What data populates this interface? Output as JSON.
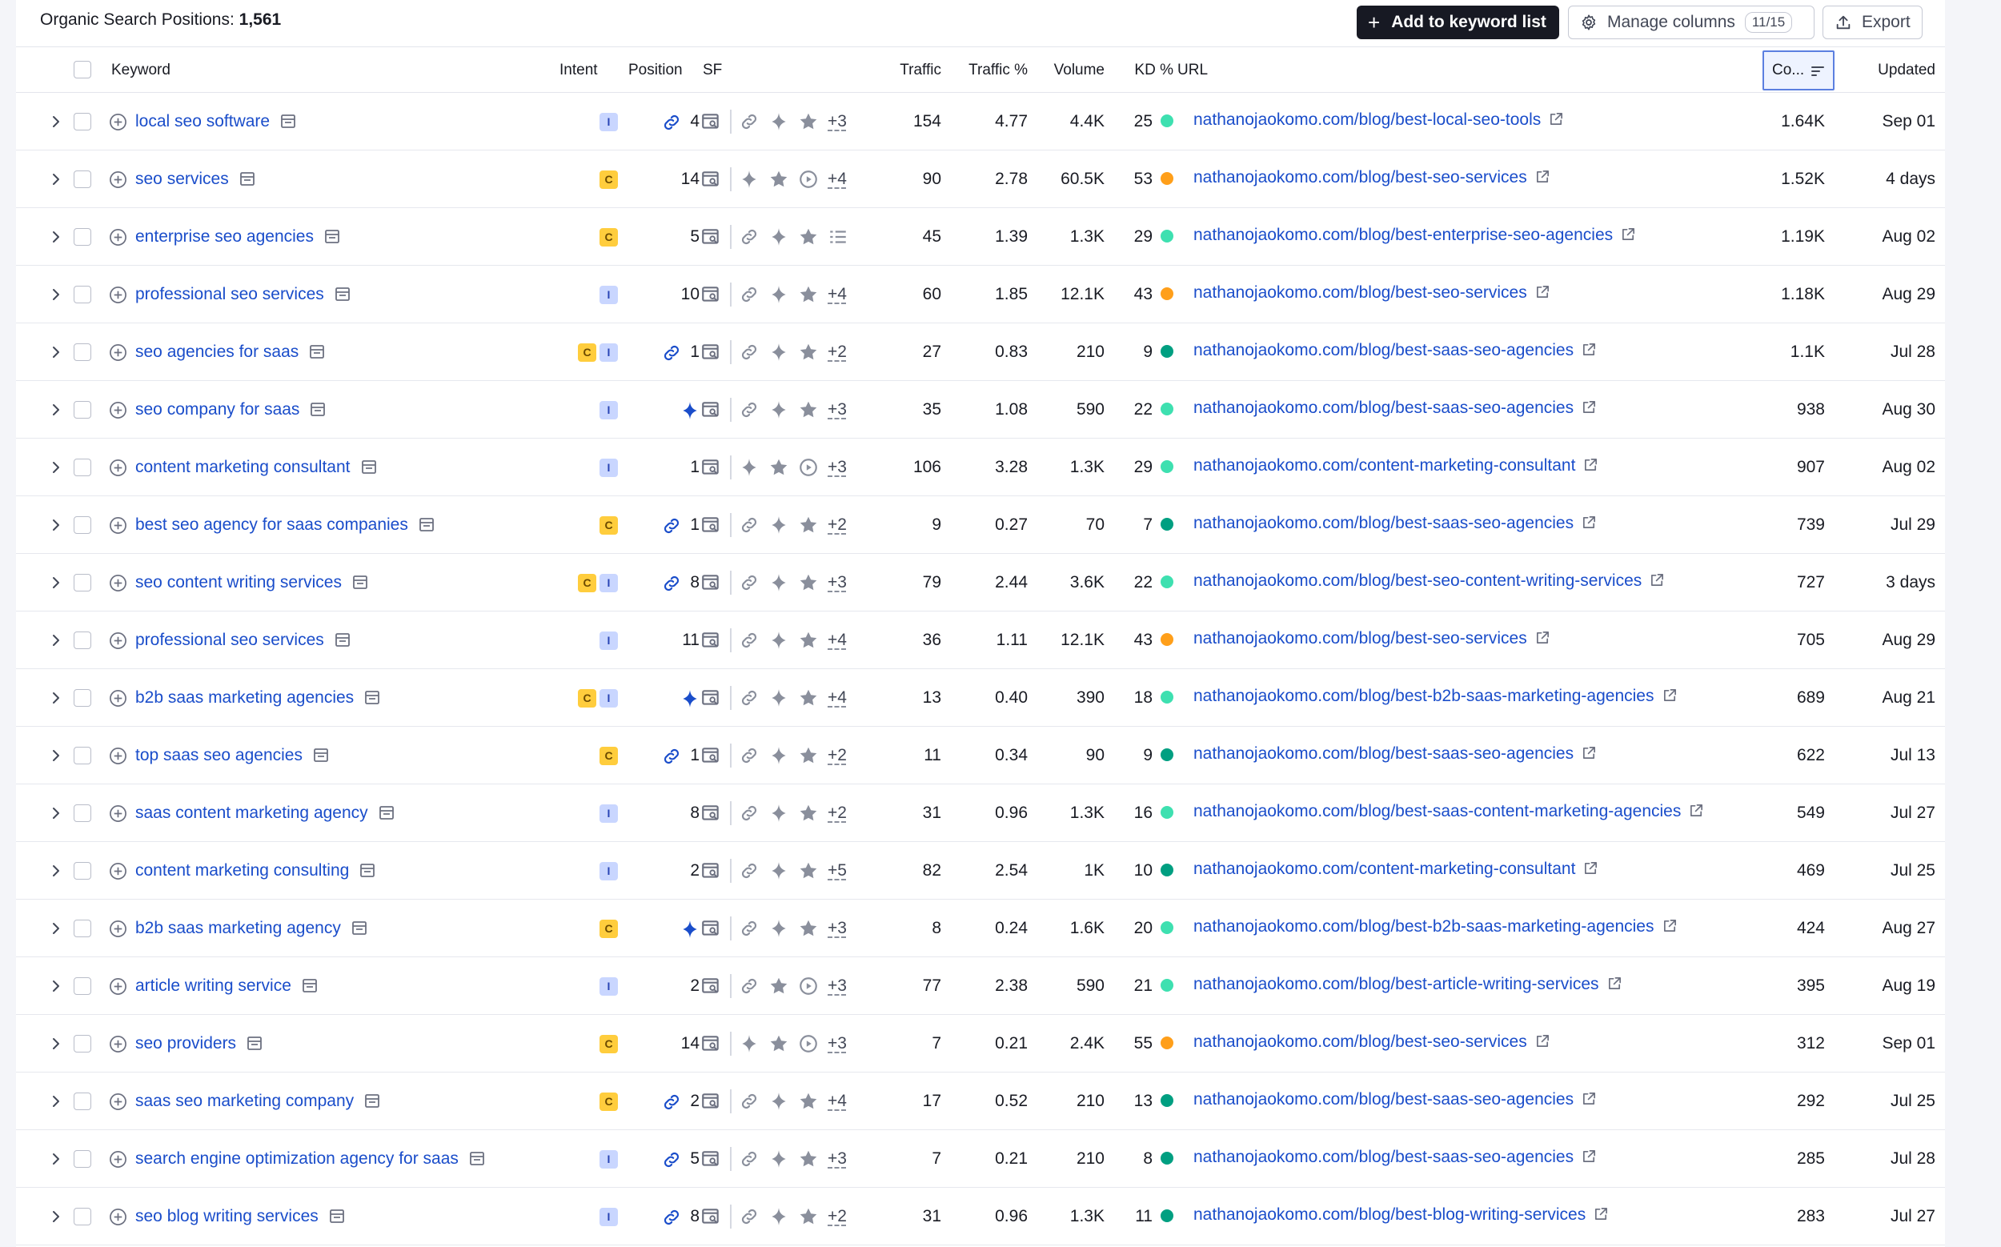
{
  "toolbar": {
    "title_label": "Organic Search Positions:",
    "title_count": "1,561",
    "add_label": "Add to keyword list",
    "manage_label": "Manage columns",
    "manage_count": "11/15",
    "export_label": "Export"
  },
  "columns": {
    "keyword": "Keyword",
    "intent": "Intent",
    "position": "Position",
    "sf": "SF",
    "traffic": "Traffic",
    "traffic_pct": "Traffic %",
    "volume": "Volume",
    "kd": "KD %",
    "url": "URL",
    "cost": "Co...",
    "updated": "Updated"
  },
  "colors": {
    "link": "#1a4dca",
    "kd_easy": "#3ee0b0",
    "kd_medium_easy": "#009f81",
    "kd_possible": "#ff9f1a",
    "intent_commercial": "#ffcd3d",
    "intent_informational": "#c9d6ff"
  },
  "rows": [
    {
      "keyword": "local seo software",
      "intent": [
        "I"
      ],
      "pos_icon": "link-icon",
      "position": "4",
      "sf": [
        "serp-icon",
        "link-icon",
        "sparkle-icon",
        "star-icon"
      ],
      "sf_more": "+3",
      "traffic": "154",
      "traffic_pct": "4.77",
      "volume": "4.4K",
      "kd": "25",
      "kd_color": "#3ee0b0",
      "url": "nathanojaokomo.com/blog/best-local-seo-tools",
      "cost": "1.64K",
      "updated": "Sep 01"
    },
    {
      "keyword": "seo services",
      "intent": [
        "C"
      ],
      "pos_icon": "",
      "position": "14",
      "sf": [
        "serp-icon",
        "sparkle-icon",
        "star-icon",
        "play-icon"
      ],
      "sf_more": "+4",
      "traffic": "90",
      "traffic_pct": "2.78",
      "volume": "60.5K",
      "kd": "53",
      "kd_color": "#ff9f1a",
      "url": "nathanojaokomo.com/blog/best-seo-services",
      "cost": "1.52K",
      "updated": "4 days"
    },
    {
      "keyword": "enterprise seo agencies",
      "intent": [
        "C"
      ],
      "pos_icon": "",
      "position": "5",
      "sf": [
        "serp-icon",
        "link-icon",
        "sparkle-icon",
        "star-icon",
        "list-icon"
      ],
      "sf_more": "",
      "traffic": "45",
      "traffic_pct": "1.39",
      "volume": "1.3K",
      "kd": "29",
      "kd_color": "#3ee0b0",
      "url": "nathanojaokomo.com/blog/best-enterprise-seo-agencies",
      "cost": "1.19K",
      "updated": "Aug 02"
    },
    {
      "keyword": "professional seo services",
      "intent": [
        "I"
      ],
      "pos_icon": "",
      "position": "10",
      "sf": [
        "serp-icon",
        "link-icon",
        "sparkle-icon",
        "star-icon"
      ],
      "sf_more": "+4",
      "traffic": "60",
      "traffic_pct": "1.85",
      "volume": "12.1K",
      "kd": "43",
      "kd_color": "#ff9f1a",
      "url": "nathanojaokomo.com/blog/best-seo-services",
      "cost": "1.18K",
      "updated": "Aug 29"
    },
    {
      "keyword": "seo agencies for saas",
      "intent": [
        "C",
        "I"
      ],
      "pos_icon": "link-icon",
      "position": "1",
      "sf": [
        "serp-icon",
        "link-icon",
        "sparkle-icon",
        "star-icon"
      ],
      "sf_more": "+2",
      "traffic": "27",
      "traffic_pct": "0.83",
      "volume": "210",
      "kd": "9",
      "kd_color": "#009f81",
      "url": "nathanojaokomo.com/blog/best-saas-seo-agencies",
      "cost": "1.1K",
      "updated": "Jul 28"
    },
    {
      "keyword": "seo company for saas",
      "intent": [
        "I"
      ],
      "pos_icon": "sparkle-icon",
      "position": "",
      "sf": [
        "serp-icon",
        "link-icon",
        "sparkle-icon",
        "star-icon"
      ],
      "sf_more": "+3",
      "traffic": "35",
      "traffic_pct": "1.08",
      "volume": "590",
      "kd": "22",
      "kd_color": "#3ee0b0",
      "url": "nathanojaokomo.com/blog/best-saas-seo-agencies",
      "cost": "938",
      "updated": "Aug 30"
    },
    {
      "keyword": "content marketing consultant",
      "intent": [
        "I"
      ],
      "pos_icon": "",
      "position": "1",
      "sf": [
        "serp-icon",
        "sparkle-icon",
        "star-icon",
        "play-icon"
      ],
      "sf_more": "+3",
      "traffic": "106",
      "traffic_pct": "3.28",
      "volume": "1.3K",
      "kd": "29",
      "kd_color": "#3ee0b0",
      "url": "nathanojaokomo.com/content-marketing-consultant",
      "cost": "907",
      "updated": "Aug 02"
    },
    {
      "keyword": "best seo agency for saas companies",
      "intent": [
        "C"
      ],
      "pos_icon": "link-icon",
      "position": "1",
      "sf": [
        "serp-icon",
        "link-icon",
        "sparkle-icon",
        "star-icon"
      ],
      "sf_more": "+2",
      "traffic": "9",
      "traffic_pct": "0.27",
      "volume": "70",
      "kd": "7",
      "kd_color": "#009f81",
      "url": "nathanojaokomo.com/blog/best-saas-seo-agencies",
      "cost": "739",
      "updated": "Jul 29"
    },
    {
      "keyword": "seo content writing services",
      "intent": [
        "C",
        "I"
      ],
      "pos_icon": "link-icon",
      "position": "8",
      "sf": [
        "serp-icon",
        "link-icon",
        "sparkle-icon",
        "star-icon"
      ],
      "sf_more": "+3",
      "traffic": "79",
      "traffic_pct": "2.44",
      "volume": "3.6K",
      "kd": "22",
      "kd_color": "#3ee0b0",
      "url": "nathanojaokomo.com/blog/best-seo-content-writing-services",
      "cost": "727",
      "updated": "3 days"
    },
    {
      "keyword": "professional seo services",
      "intent": [
        "I"
      ],
      "pos_icon": "",
      "position": "11",
      "sf": [
        "serp-icon",
        "link-icon",
        "sparkle-icon",
        "star-icon"
      ],
      "sf_more": "+4",
      "traffic": "36",
      "traffic_pct": "1.11",
      "volume": "12.1K",
      "kd": "43",
      "kd_color": "#ff9f1a",
      "url": "nathanojaokomo.com/blog/best-seo-services",
      "cost": "705",
      "updated": "Aug 29"
    },
    {
      "keyword": "b2b saas marketing agencies",
      "intent": [
        "C",
        "I"
      ],
      "pos_icon": "sparkle-icon",
      "position": "",
      "sf": [
        "serp-icon",
        "link-icon",
        "sparkle-icon",
        "star-icon"
      ],
      "sf_more": "+4",
      "traffic": "13",
      "traffic_pct": "0.40",
      "volume": "390",
      "kd": "18",
      "kd_color": "#3ee0b0",
      "url": "nathanojaokomo.com/blog/best-b2b-saas-marketing-agencies",
      "cost": "689",
      "updated": "Aug 21"
    },
    {
      "keyword": "top saas seo agencies",
      "intent": [
        "C"
      ],
      "pos_icon": "link-icon",
      "position": "1",
      "sf": [
        "serp-icon",
        "link-icon",
        "sparkle-icon",
        "star-icon"
      ],
      "sf_more": "+2",
      "traffic": "11",
      "traffic_pct": "0.34",
      "volume": "90",
      "kd": "9",
      "kd_color": "#009f81",
      "url": "nathanojaokomo.com/blog/best-saas-seo-agencies",
      "cost": "622",
      "updated": "Jul 13"
    },
    {
      "keyword": "saas content marketing agency",
      "intent": [
        "I"
      ],
      "pos_icon": "",
      "position": "8",
      "sf": [
        "serp-icon",
        "link-icon",
        "sparkle-icon",
        "star-icon"
      ],
      "sf_more": "+2",
      "traffic": "31",
      "traffic_pct": "0.96",
      "volume": "1.3K",
      "kd": "16",
      "kd_color": "#3ee0b0",
      "url": "nathanojaokomo.com/blog/best-saas-content-marketing-agencies",
      "cost": "549",
      "updated": "Jul 27"
    },
    {
      "keyword": "content marketing consulting",
      "intent": [
        "I"
      ],
      "pos_icon": "",
      "position": "2",
      "sf": [
        "serp-icon",
        "link-icon",
        "sparkle-icon",
        "star-icon"
      ],
      "sf_more": "+5",
      "traffic": "82",
      "traffic_pct": "2.54",
      "volume": "1K",
      "kd": "10",
      "kd_color": "#009f81",
      "url": "nathanojaokomo.com/content-marketing-consultant",
      "cost": "469",
      "updated": "Jul 25"
    },
    {
      "keyword": "b2b saas marketing agency",
      "intent": [
        "C"
      ],
      "pos_icon": "sparkle-icon",
      "position": "",
      "sf": [
        "serp-icon",
        "link-icon",
        "sparkle-icon",
        "star-icon"
      ],
      "sf_more": "+3",
      "traffic": "8",
      "traffic_pct": "0.24",
      "volume": "1.6K",
      "kd": "20",
      "kd_color": "#3ee0b0",
      "url": "nathanojaokomo.com/blog/best-b2b-saas-marketing-agencies",
      "cost": "424",
      "updated": "Aug 27"
    },
    {
      "keyword": "article writing service",
      "intent": [
        "I"
      ],
      "pos_icon": "",
      "position": "2",
      "sf": [
        "serp-icon",
        "link-icon",
        "star-icon",
        "play-icon"
      ],
      "sf_more": "+3",
      "traffic": "77",
      "traffic_pct": "2.38",
      "volume": "590",
      "kd": "21",
      "kd_color": "#3ee0b0",
      "url": "nathanojaokomo.com/blog/best-article-writing-services",
      "cost": "395",
      "updated": "Aug 19"
    },
    {
      "keyword": "seo providers",
      "intent": [
        "C"
      ],
      "pos_icon": "",
      "position": "14",
      "sf": [
        "serp-icon",
        "sparkle-icon",
        "star-icon",
        "play-icon"
      ],
      "sf_more": "+3",
      "traffic": "7",
      "traffic_pct": "0.21",
      "volume": "2.4K",
      "kd": "55",
      "kd_color": "#ff9f1a",
      "url": "nathanojaokomo.com/blog/best-seo-services",
      "cost": "312",
      "updated": "Sep 01"
    },
    {
      "keyword": "saas seo marketing company",
      "intent": [
        "C"
      ],
      "pos_icon": "link-icon",
      "position": "2",
      "sf": [
        "serp-icon",
        "link-icon",
        "sparkle-icon",
        "star-icon"
      ],
      "sf_more": "+4",
      "traffic": "17",
      "traffic_pct": "0.52",
      "volume": "210",
      "kd": "13",
      "kd_color": "#009f81",
      "url": "nathanojaokomo.com/blog/best-saas-seo-agencies",
      "cost": "292",
      "updated": "Jul 25"
    },
    {
      "keyword": "search engine optimization agency for saas",
      "intent": [
        "I"
      ],
      "pos_icon": "link-icon",
      "position": "5",
      "sf": [
        "serp-icon",
        "link-icon",
        "sparkle-icon",
        "star-icon"
      ],
      "sf_more": "+3",
      "traffic": "7",
      "traffic_pct": "0.21",
      "volume": "210",
      "kd": "8",
      "kd_color": "#009f81",
      "url": "nathanojaokomo.com/blog/best-saas-seo-agencies",
      "cost": "285",
      "updated": "Jul 28"
    },
    {
      "keyword": "seo blog writing services",
      "intent": [
        "I"
      ],
      "pos_icon": "link-icon",
      "position": "8",
      "sf": [
        "serp-icon",
        "link-icon",
        "sparkle-icon",
        "star-icon"
      ],
      "sf_more": "+2",
      "traffic": "31",
      "traffic_pct": "0.96",
      "volume": "1.3K",
      "kd": "11",
      "kd_color": "#009f81",
      "url": "nathanojaokomo.com/blog/best-blog-writing-services",
      "cost": "283",
      "updated": "Jul 27"
    }
  ]
}
